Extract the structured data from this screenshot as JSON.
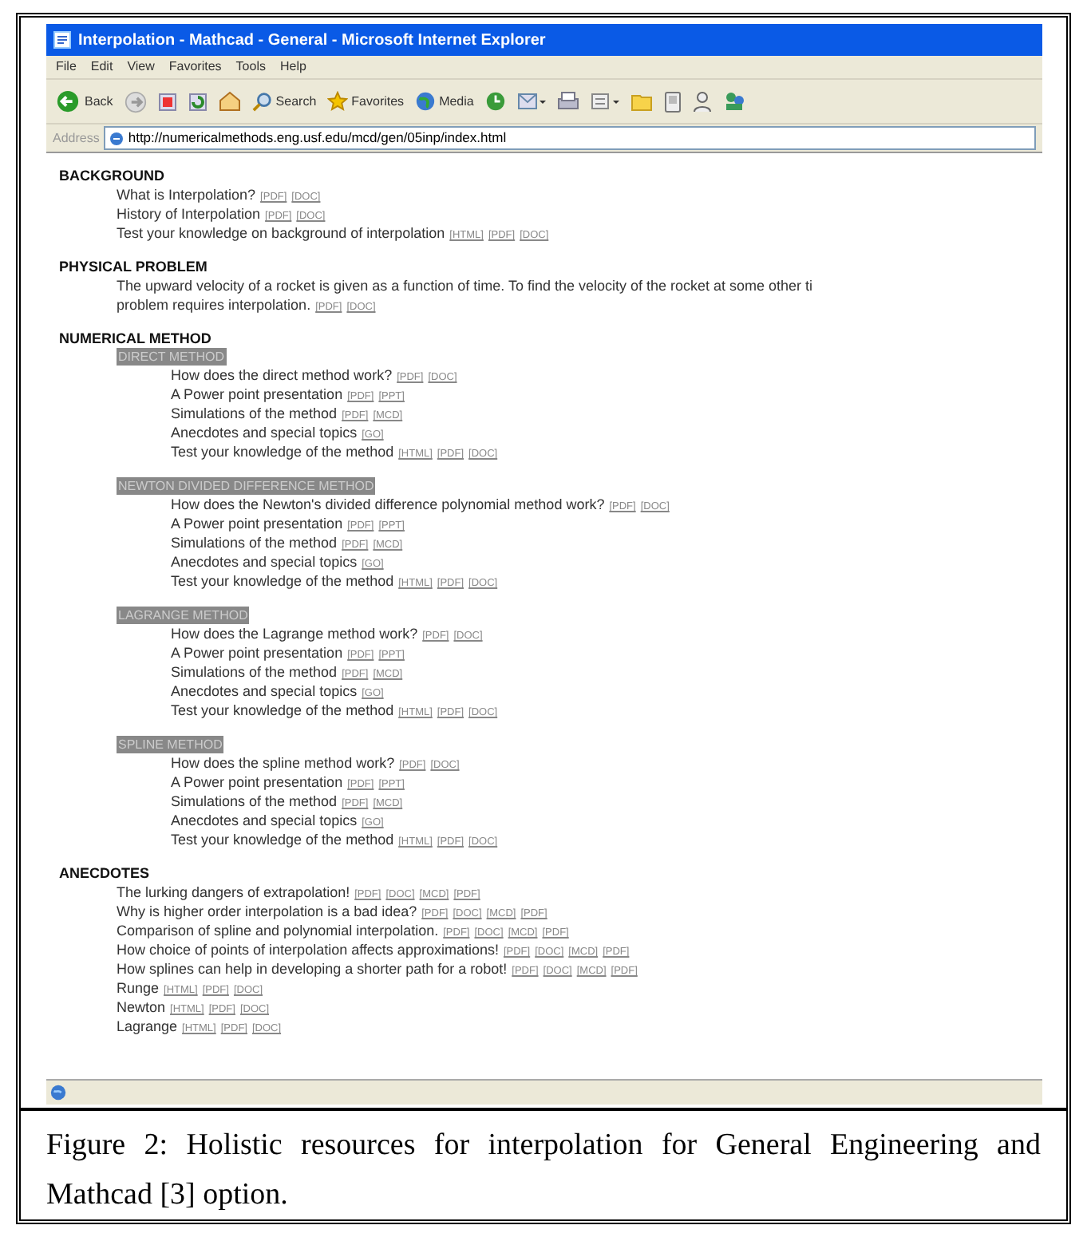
{
  "window": {
    "title": "Interpolation - Mathcad - General - Microsoft Internet Explorer"
  },
  "menu": [
    "File",
    "Edit",
    "View",
    "Favorites",
    "Tools",
    "Help"
  ],
  "toolbar": {
    "back": "Back",
    "search": "Search",
    "favorites": "Favorites",
    "media": "Media"
  },
  "address": {
    "label": "Address",
    "url": "http://numericalmethods.eng.usf.edu/mcd/gen/05inp/index.html"
  },
  "sections": [
    {
      "heading": "BACKGROUND",
      "kind": "list",
      "items": [
        {
          "text": "What is Interpolation?",
          "links": [
            "[PDF]",
            "[DOC]"
          ]
        },
        {
          "text": "History of Interpolation",
          "links": [
            "[PDF]",
            "[DOC]"
          ]
        },
        {
          "text": "Test your knowledge on background of interpolation",
          "links": [
            "[HTML]",
            "[PDF]",
            "[DOC]"
          ]
        }
      ]
    },
    {
      "heading": "PHYSICAL PROBLEM",
      "kind": "paragraph",
      "lines": [
        "The upward velocity of a rocket is given as a function of time. To find the velocity of the rocket at some other ti",
        "problem requires interpolation."
      ],
      "links": [
        "[PDF]",
        "[DOC]"
      ]
    },
    {
      "heading": "NUMERICAL METHOD",
      "kind": "methods",
      "methods": [
        {
          "title": "DIRECT METHOD",
          "items": [
            {
              "text": "How does the direct method work?",
              "links": [
                "[PDF]",
                "[DOC]"
              ]
            },
            {
              "text": "A Power point presentation",
              "links": [
                "[PDF]",
                "[PPT]"
              ]
            },
            {
              "text": "Simulations of the method",
              "links": [
                "[PDF]",
                "[MCD]"
              ]
            },
            {
              "text": "Anecdotes and special topics",
              "links": [
                "[GO]"
              ]
            },
            {
              "text": "Test your knowledge of the method",
              "links": [
                "[HTML]",
                "[PDF]",
                "[DOC]"
              ]
            }
          ]
        },
        {
          "title": "NEWTON DIVIDED DIFFERENCE METHOD",
          "items": [
            {
              "text": "How does the Newton's divided difference polynomial method work?",
              "links": [
                "[PDF]",
                "[DOC]"
              ]
            },
            {
              "text": "A Power point presentation",
              "links": [
                "[PDF]",
                "[PPT]"
              ]
            },
            {
              "text": "Simulations of the method",
              "links": [
                "[PDF]",
                "[MCD]"
              ]
            },
            {
              "text": "Anecdotes and special topics",
              "links": [
                "[GO]"
              ]
            },
            {
              "text": "Test your knowledge of the method",
              "links": [
                "[HTML]",
                "[PDF]",
                "[DOC]"
              ]
            }
          ]
        },
        {
          "title": "LAGRANGE METHOD",
          "items": [
            {
              "text": "How does the Lagrange method work?",
              "links": [
                "[PDF]",
                "[DOC]"
              ]
            },
            {
              "text": "A Power point presentation",
              "links": [
                "[PDF]",
                "[PPT]"
              ]
            },
            {
              "text": "Simulations of the method",
              "links": [
                "[PDF]",
                "[MCD]"
              ]
            },
            {
              "text": "Anecdotes and special topics",
              "links": [
                "[GO]"
              ]
            },
            {
              "text": "Test your knowledge of the method",
              "links": [
                "[HTML]",
                "[PDF]",
                "[DOC]"
              ]
            }
          ]
        },
        {
          "title": "SPLINE METHOD",
          "items": [
            {
              "text": "How does the spline method work?",
              "links": [
                "[PDF]",
                "[DOC]"
              ]
            },
            {
              "text": "A Power point presentation",
              "links": [
                "[PDF]",
                "[PPT]"
              ]
            },
            {
              "text": "Simulations of the method",
              "links": [
                "[PDF]",
                "[MCD]"
              ]
            },
            {
              "text": "Anecdotes and special topics",
              "links": [
                "[GO]"
              ]
            },
            {
              "text": "Test your knowledge of the method",
              "links": [
                "[HTML]",
                "[PDF]",
                "[DOC]"
              ]
            }
          ]
        }
      ]
    },
    {
      "heading": "ANECDOTES",
      "kind": "list",
      "items": [
        {
          "text": "The lurking dangers of extrapolation!",
          "links": [
            "[PDF]",
            "[DOC]",
            "[MCD]",
            "[PDF]"
          ]
        },
        {
          "text": "Why is higher order interpolation is a bad idea?",
          "links": [
            "[PDF]",
            "[DOC]",
            "[MCD]",
            "[PDF]"
          ]
        },
        {
          "text": "Comparison of spline and polynomial interpolation.",
          "links": [
            "[PDF]",
            "[DOC]",
            "[MCD]",
            "[PDF]"
          ]
        },
        {
          "text": "How choice of points of interpolation affects approximations!",
          "links": [
            "[PDF]",
            "[DOC]",
            "[MCD]",
            "[PDF]"
          ]
        },
        {
          "text": "How splines can help in developing a shorter path for a robot!",
          "links": [
            "[PDF]",
            "[DOC]",
            "[MCD]",
            "[PDF]"
          ]
        },
        {
          "text": "Runge",
          "links": [
            "[HTML]",
            "[PDF]",
            "[DOC]"
          ]
        },
        {
          "text": "Newton",
          "links": [
            "[HTML]",
            "[PDF]",
            "[DOC]"
          ]
        },
        {
          "text": "Lagrange",
          "links": [
            "[HTML]",
            "[PDF]",
            "[DOC]"
          ]
        }
      ]
    }
  ],
  "caption": "Figure 2: Holistic resources for interpolation for General Engineering and Mathcad [3] option."
}
